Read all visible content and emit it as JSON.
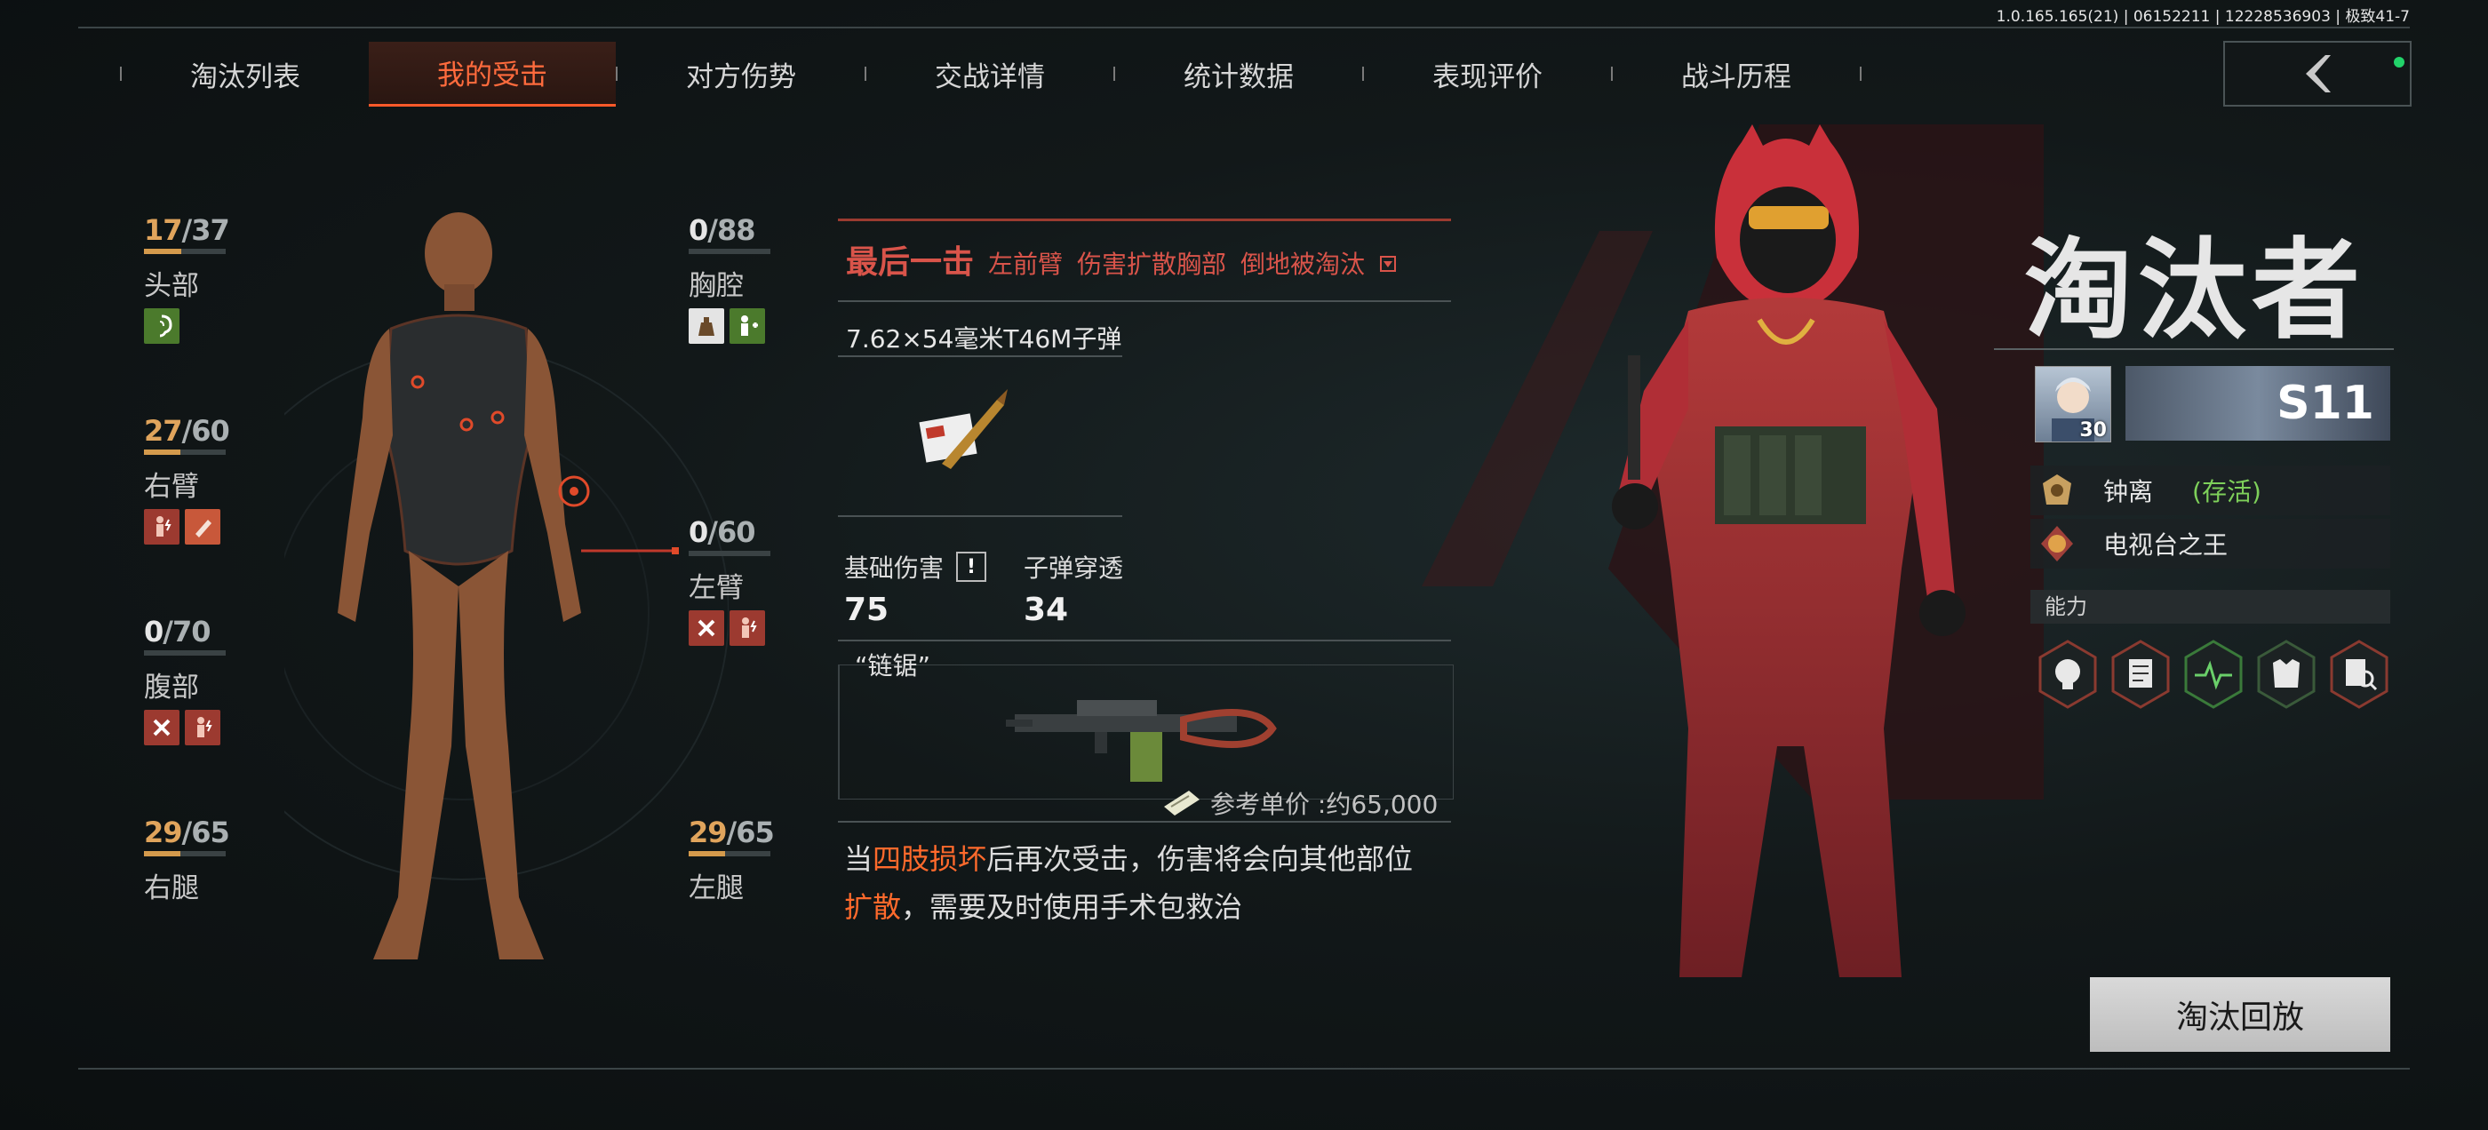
{
  "version": "1.0.165.165(21) | 06152211 | 12228536903 | 极致41-7",
  "tabs": [
    {
      "label": "淘汰列表"
    },
    {
      "label": "我的受击"
    },
    {
      "label": "对方伤势"
    },
    {
      "label": "交战详情"
    },
    {
      "label": "统计数据"
    },
    {
      "label": "表现评价"
    },
    {
      "label": "战斗历程"
    }
  ],
  "active_tab": "我的受击",
  "body_parts": {
    "head": {
      "cur": "17",
      "max": "37",
      "name": "头部",
      "fraction": 0.46
    },
    "chest": {
      "cur": "0",
      "max": "88",
      "name": "胸腔",
      "fraction": 0
    },
    "right_arm": {
      "cur": "27",
      "max": "60",
      "name": "右臂",
      "fraction": 0.45
    },
    "left_arm": {
      "cur": "0",
      "max": "60",
      "name": "左臂",
      "fraction": 0
    },
    "abdomen": {
      "cur": "0",
      "max": "70",
      "name": "腹部",
      "fraction": 0
    },
    "right_leg": {
      "cur": "29",
      "max": "65",
      "name": "右腿",
      "fraction": 0.45
    },
    "left_leg": {
      "cur": "29",
      "max": "65",
      "name": "左腿",
      "fraction": 0.45
    }
  },
  "hit_info": {
    "final_blow": "最后一击",
    "part": "左前臂",
    "spread": "伤害扩散胸部",
    "result": "倒地被淘汰",
    "ammo": "7.62×54毫米T46M子弹",
    "base_damage_label": "基础伤害",
    "base_damage": "75",
    "penetration_label": "子弹穿透",
    "penetration": "34",
    "weapon": "“链锯”",
    "price": "参考单价 :约65,000",
    "desc_pre": "当",
    "desc_hl1": "四肢损坏",
    "desc_mid": "后再次受击，伤害将会向其他部位",
    "desc_hl2": "扩散",
    "desc_post": "，需要及时使用手术包救治"
  },
  "killer": {
    "title": "淘汰者",
    "level": "30",
    "season_badge": "S11",
    "name": "钟离",
    "status": "(存活)",
    "title_badge": "电视台之王",
    "ability_label": "能力"
  },
  "replay_button": "淘汰回放",
  "colors": {
    "accent": "#ff6b3d",
    "hp": "#e0a45c",
    "alive": "#7ed05a",
    "hit_red": "#d9544a"
  }
}
